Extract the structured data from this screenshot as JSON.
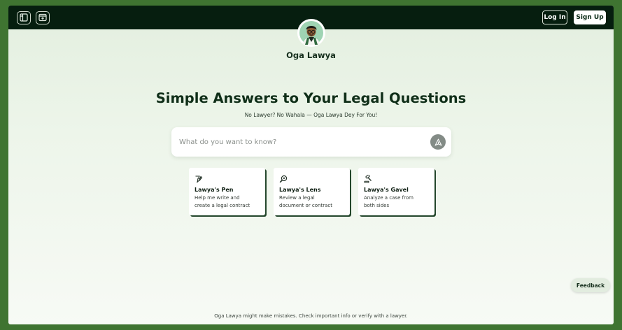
{
  "header": {
    "login_label": "Log In",
    "signup_label": "Sign Up",
    "icons": [
      "sidebar-toggle-icon",
      "new-chat-icon"
    ]
  },
  "brand": {
    "name": "Oga Lawya",
    "avatar_icon": "lawyer-avatar"
  },
  "hero": {
    "title": "Simple Answers to Your Legal Questions",
    "subtitle": "No Lawyer? No Wahala — Oga Lawya Dey For You!"
  },
  "search": {
    "placeholder": "What do you want to know?",
    "value": "",
    "send_icon": "send-icon"
  },
  "cards": [
    {
      "icon": "pen-icon",
      "title": "Lawya's Pen",
      "line1": "Help me write and",
      "line2": "create a legal contract"
    },
    {
      "icon": "lens-icon",
      "title": "Lawya's Lens",
      "line1": "Review a legal",
      "line2": "document or contract"
    },
    {
      "icon": "gavel-icon",
      "title": "Lawya's Gavel",
      "line1": "Analyze a case from",
      "line2": "both sides"
    }
  ],
  "feedback_label": "Feedback",
  "disclaimer": "Oga Lawya might make mistakes. Check important info or verify with a lawyer.",
  "colors": {
    "topbar": "#061e0f",
    "outer_frame": "#3f7431",
    "card_shadow": "#23462b",
    "send_button": "#838b86"
  }
}
